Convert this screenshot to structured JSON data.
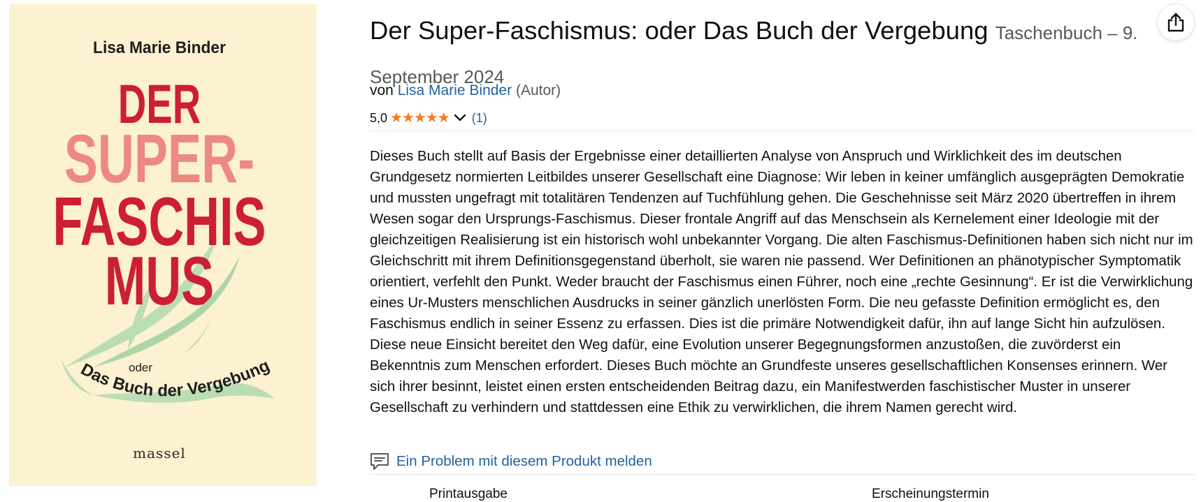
{
  "cover": {
    "author": "Lisa Marie Binder",
    "line1": "DER",
    "line2": "SUPER-",
    "line3": "FASCHIS",
    "line4": "MUS",
    "oder": "oder",
    "subtitle": "Das Buch der Vergebung",
    "publisher": "massel"
  },
  "product": {
    "title": "Der Super-Faschismus: oder Das Buch der Vergebung",
    "edition": "Taschenbuch – 9. September 2024",
    "by_prefix": "von",
    "author": "Lisa Marie Binder",
    "role": "(Autor)",
    "rating_value": "5,0",
    "rating_stars": 5,
    "rating_count": "(1)",
    "description": "Dieses Buch stellt auf Basis der Ergebnisse einer detaillierten Analyse von Anspruch und Wirklichkeit des im deutschen Grundgesetz normierten Leitbildes unserer Gesellschaft eine Diagnose: Wir leben in keiner umfänglich ausgeprägten Demokratie und mussten ungefragt mit totalitären Tendenzen auf Tuchfühlung gehen. Die Geschehnisse seit März 2020 übertreffen in ihrem Wesen sogar den Ursprungs-Faschismus. Dieser frontale Angriff auf das Menschsein als Kernelement einer Ideologie mit der gleichzeitigen Realisierung ist ein historisch wohl unbekannter Vorgang. Die alten Faschismus-Definitionen haben sich nicht nur im Gleichschritt mit ihrem Definitionsgegenstand überholt, sie waren nie passend. Wer Definitionen an phänotypischer Symptomatik orientiert, verfehlt den Punkt. Weder braucht der Faschismus einen Führer, noch eine „rechte Gesinnung“. Er ist die Verwirklichung eines Ur-Musters menschlichen Ausdrucks in seiner gänzlich unerlösten Form. Die neu gefasste Definition ermöglicht es, den Faschismus endlich in seiner Essenz zu erfassen. Dies ist die primäre Notwendigkeit dafür, ihn auf lange Sicht hin aufzulösen. Diese neue Einsicht bereitet den Weg dafür, eine Evolution unserer Begegnungsformen anzustoßen, die zuvörderst ein Bekenntnis zum Menschen erfordert. Dieses Buch möchte an Grundfeste unseres gesellschaftlichen Konsenses erinnern. Wer sich ihrer besinnt, leistet einen ersten entscheidenden Beitrag dazu, ein Manifestwerden faschistischer Muster in unserer Gesellschaft zu verhindern und stattdessen eine Ethik zu verwirklichen, die ihrem Namen gerecht wird.",
    "report_link": "Ein Problem mit diesem Produkt melden",
    "cut_off_left": "Printausgabe",
    "cut_off_right": "Erscheinungstermin"
  },
  "colors": {
    "link": "#2162a1",
    "star": "#f57a1c",
    "cover_bg": "#fcf1d0",
    "cover_red": "#cc1e35",
    "cover_pink": "#ec8a82",
    "cover_green": "#a9d4a4"
  },
  "icons": {
    "share": "share-icon",
    "report": "speech-bubble-icon",
    "caret": "chevron-down-icon",
    "star": "star-icon"
  }
}
